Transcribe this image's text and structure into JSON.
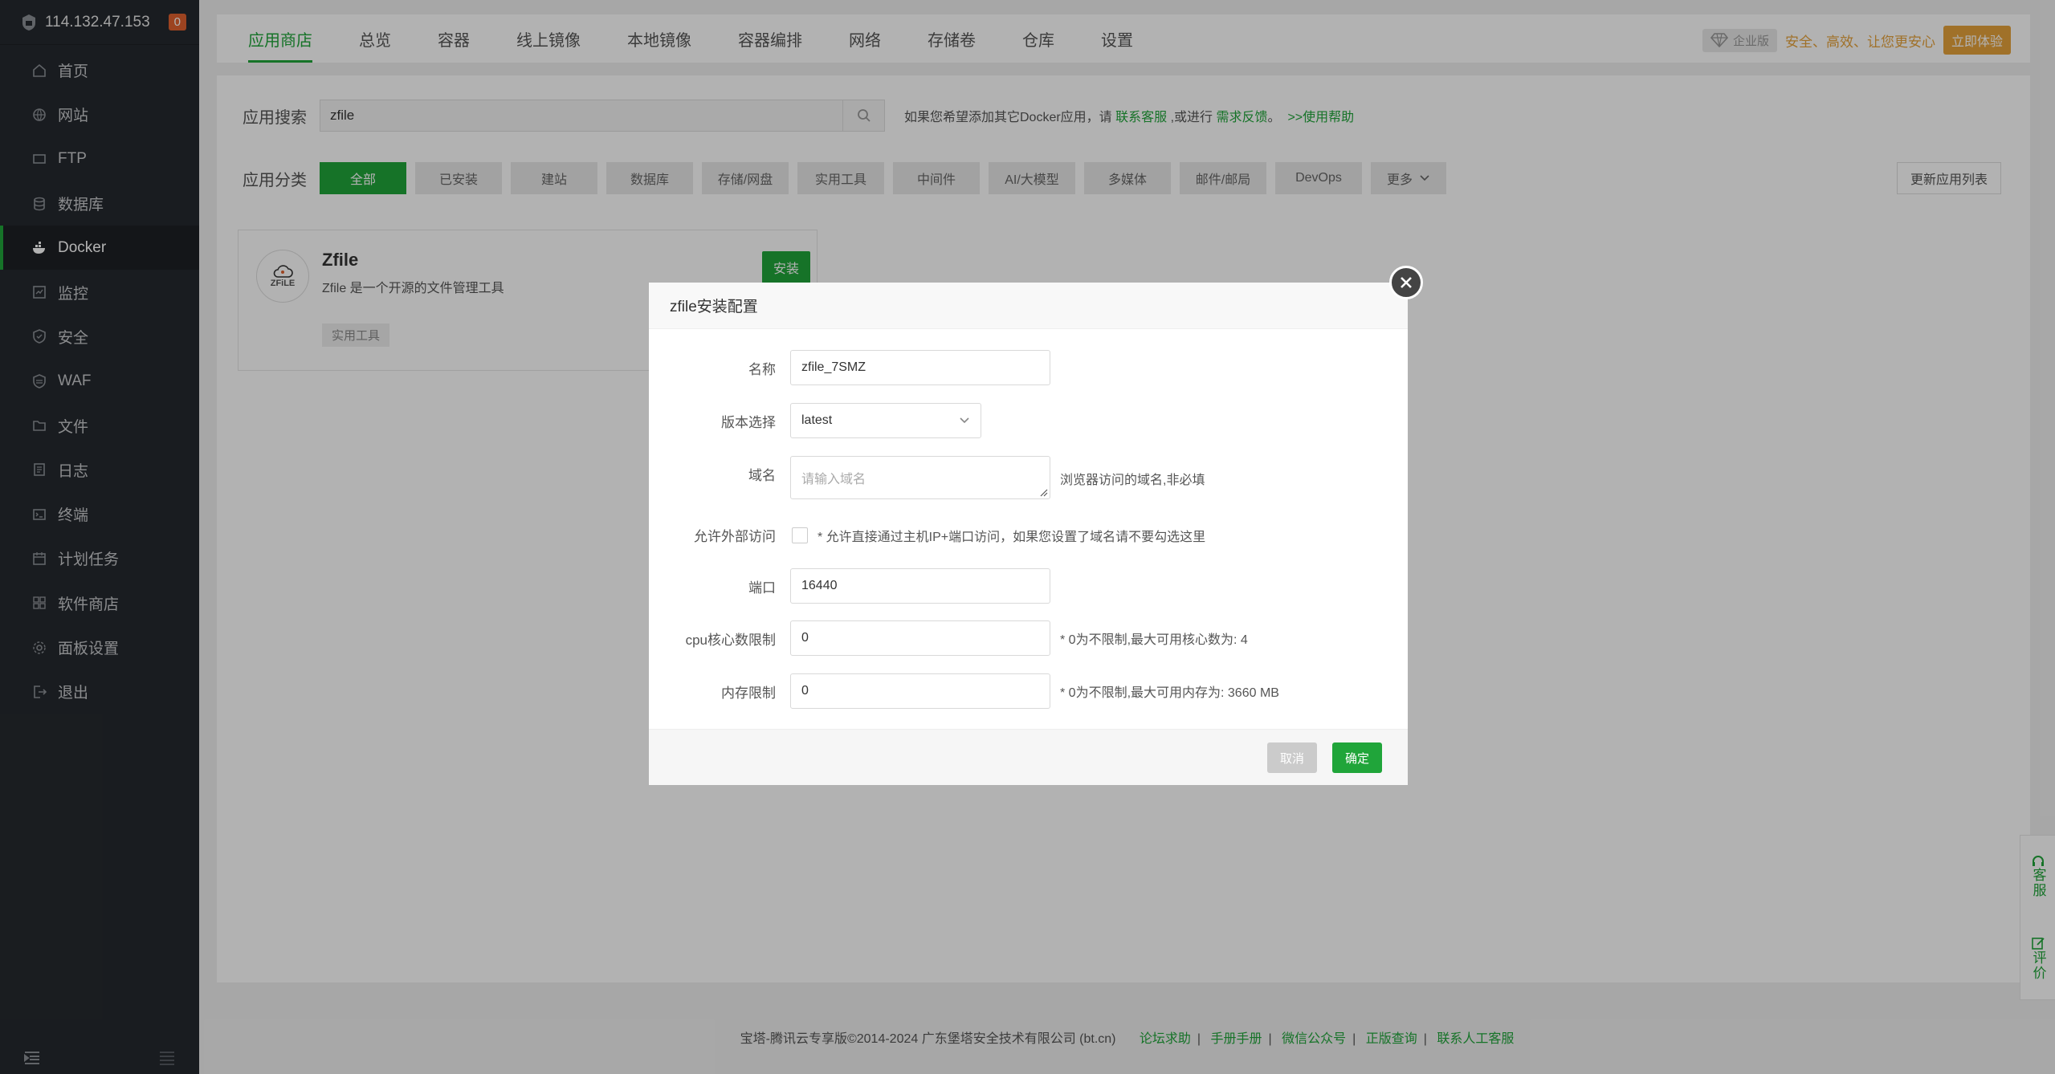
{
  "sidebar": {
    "ip": "114.132.47.153",
    "badge": "0",
    "items": [
      {
        "label": "首页",
        "icon": "home-icon"
      },
      {
        "label": "网站",
        "icon": "globe-icon"
      },
      {
        "label": "FTP",
        "icon": "ftp-icon"
      },
      {
        "label": "数据库",
        "icon": "database-icon"
      },
      {
        "label": "Docker",
        "icon": "docker-icon"
      },
      {
        "label": "监控",
        "icon": "monitor-icon"
      },
      {
        "label": "安全",
        "icon": "shield-icon"
      },
      {
        "label": "WAF",
        "icon": "waf-icon"
      },
      {
        "label": "文件",
        "icon": "folder-icon"
      },
      {
        "label": "日志",
        "icon": "log-icon"
      },
      {
        "label": "终端",
        "icon": "terminal-icon"
      },
      {
        "label": "计划任务",
        "icon": "calendar-icon"
      },
      {
        "label": "软件商店",
        "icon": "apps-icon"
      },
      {
        "label": "面板设置",
        "icon": "gear-icon"
      },
      {
        "label": "退出",
        "icon": "logout-icon"
      }
    ],
    "active_index": 4
  },
  "topnav": {
    "tabs": [
      "应用商店",
      "总览",
      "容器",
      "线上镜像",
      "本地镜像",
      "容器编排",
      "网络",
      "存储卷",
      "仓库",
      "设置"
    ],
    "enterprise_tag": "企业版",
    "slogan": "安全、高效、让您更安心",
    "try_button": "立即体验"
  },
  "search": {
    "label": "应用搜索",
    "value": "zfile",
    "hint_prefix": "如果您希望添加其它Docker应用，请",
    "hint_link1": "联系客服",
    "hint_mid": ",或进行",
    "hint_link2": "需求反馈",
    "hint_dot": "。",
    "hint_link3": ">>使用帮助"
  },
  "categories": {
    "label": "应用分类",
    "items": [
      "全部",
      "已安装",
      "建站",
      "数据库",
      "存储/网盘",
      "实用工具",
      "中间件",
      "AI/大模型",
      "多媒体",
      "邮件/邮局",
      "DevOps"
    ],
    "more": "更多",
    "update_button": "更新应用列表"
  },
  "app_card": {
    "logo_text": "ZFiLE",
    "name": "Zfile",
    "description": "Zfile 是一个开源的文件管理工具",
    "tag": "实用工具",
    "install_button": "安装"
  },
  "dialog": {
    "title": "zfile安装配置",
    "fields": {
      "name_label": "名称",
      "name_value": "zfile_7SMZ",
      "version_label": "版本选择",
      "version_value": "latest",
      "domain_label": "域名",
      "domain_placeholder": "请输入域名",
      "domain_note": "浏览器访问的域名,非必填",
      "external_label": "允许外部访问",
      "external_note": "* 允许直接通过主机IP+端口访问，如果您设置了域名请不要勾选这里",
      "port_label": "端口",
      "port_value": "16440",
      "cpu_label": "cpu核心数限制",
      "cpu_value": "0",
      "cpu_note": "* 0为不限制,最大可用核心数为: 4",
      "mem_label": "内存限制",
      "mem_value": "0",
      "mem_note": "* 0为不限制,最大可用内存为: 3660 MB"
    },
    "cancel": "取消",
    "confirm": "确定"
  },
  "footer": {
    "copyright": "宝塔-腾讯云专享版©2014-2024 广东堡塔安全技术有限公司 (bt.cn)",
    "links": [
      "论坛求助",
      "手册手册",
      "微信公众号",
      "正版查询",
      "联系人工客服"
    ]
  },
  "float_panel": {
    "service": "客服",
    "review": "评价"
  },
  "colors": {
    "brand_green": "#20a53a",
    "sidebar_bg": "#25292e",
    "accent_orange": "#e6a23c",
    "badge_orange": "#e0612e"
  }
}
